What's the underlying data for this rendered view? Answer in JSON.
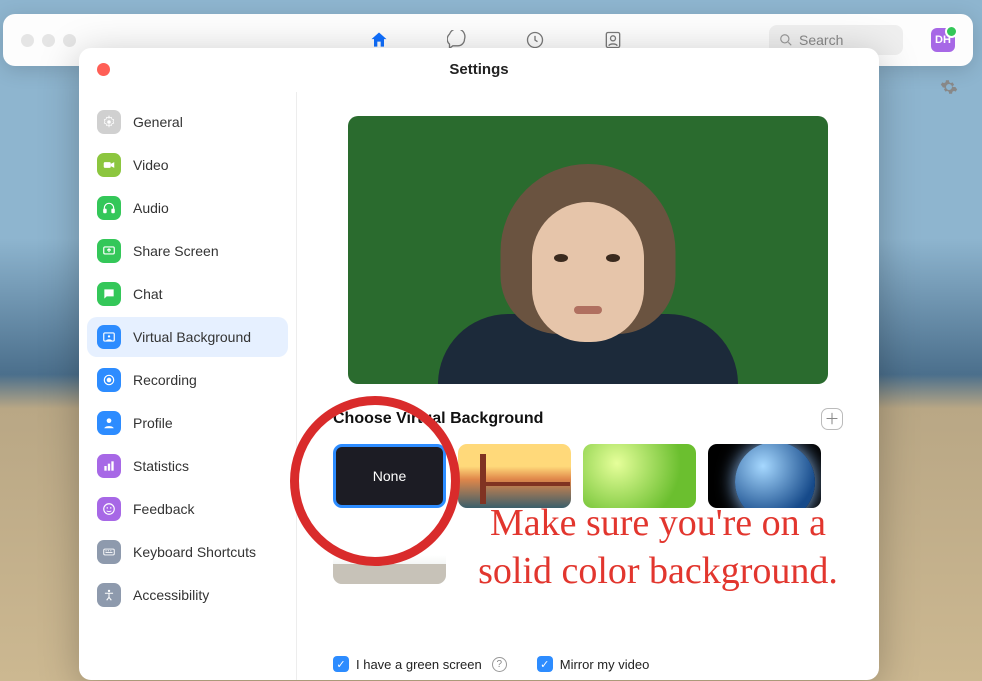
{
  "topbar": {
    "search_placeholder": "Search",
    "avatar_initials": "DH",
    "icons": {
      "home": "home-icon",
      "chat": "chat-bubble-icon",
      "clock": "clock-icon",
      "contacts": "contacts-icon"
    }
  },
  "settings": {
    "title": "Settings",
    "sidebar": {
      "items": [
        {
          "label": "General",
          "icon": "gear-icon"
        },
        {
          "label": "Video",
          "icon": "video-icon"
        },
        {
          "label": "Audio",
          "icon": "headphones-icon"
        },
        {
          "label": "Share Screen",
          "icon": "share-screen-icon"
        },
        {
          "label": "Chat",
          "icon": "chat-icon"
        },
        {
          "label": "Virtual Background",
          "icon": "virtual-bg-icon",
          "active": true
        },
        {
          "label": "Recording",
          "icon": "record-icon"
        },
        {
          "label": "Profile",
          "icon": "profile-icon"
        },
        {
          "label": "Statistics",
          "icon": "statistics-icon"
        },
        {
          "label": "Feedback",
          "icon": "feedback-icon"
        },
        {
          "label": "Keyboard Shortcuts",
          "icon": "keyboard-icon"
        },
        {
          "label": "Accessibility",
          "icon": "accessibility-icon"
        }
      ]
    },
    "vbg": {
      "section_title": "Choose Virtual Background",
      "thumbnails": [
        {
          "label": "None",
          "kind": "none",
          "selected": true
        },
        {
          "label": "",
          "kind": "bridge"
        },
        {
          "label": "",
          "kind": "grass"
        },
        {
          "label": "",
          "kind": "earth"
        },
        {
          "label": "",
          "kind": "room"
        }
      ],
      "checks": {
        "green_screen": "I have a green screen",
        "mirror": "Mirror my video"
      }
    }
  },
  "annotation": {
    "text": "Make sure you're on a solid color background."
  },
  "colors": {
    "accent": "#2d8cff",
    "annotation_red": "#e2362e"
  }
}
